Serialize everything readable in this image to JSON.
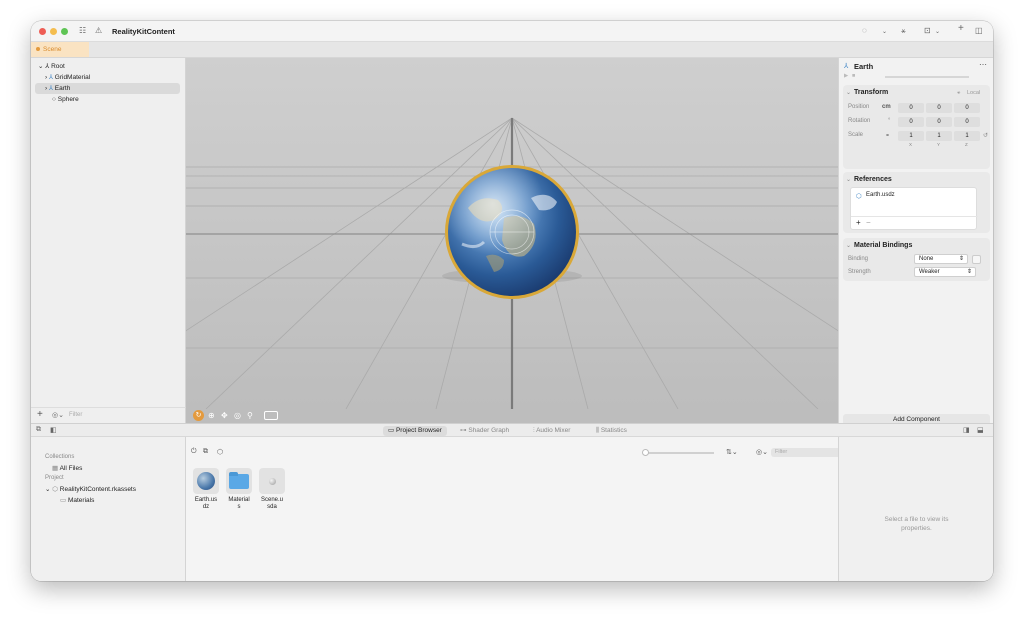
{
  "app": {
    "title": "RealityKitContent"
  },
  "tabs": {
    "scene": "Scene"
  },
  "hierarchy": {
    "root": "Root",
    "items": [
      "GridMaterial",
      "Earth",
      "Sphere"
    ],
    "filter_placeholder": "Filter"
  },
  "inspector": {
    "entity_name": "Earth",
    "transform": {
      "title": "Transform",
      "space": "Local",
      "position_label": "Position",
      "position_unit": "cm",
      "rotation_label": "Rotation",
      "rotation_unit": "°",
      "scale_label": "Scale",
      "position": [
        "0",
        "0",
        "0"
      ],
      "rotation": [
        "0",
        "0",
        "0"
      ],
      "scale": [
        "1",
        "1",
        "1"
      ],
      "axes": [
        "X",
        "Y",
        "Z"
      ]
    },
    "references": {
      "title": "References",
      "items": [
        "Earth.usdz"
      ],
      "add": "+",
      "remove": "−"
    },
    "material_bindings": {
      "title": "Material Bindings",
      "binding_label": "Binding",
      "binding_value": "None",
      "strength_label": "Strength",
      "strength_value": "Weaker"
    },
    "add_component": "Add Component"
  },
  "bottom_tabs": [
    "Project Browser",
    "Shader Graph",
    "Audio Mixer",
    "Statistics"
  ],
  "collections": {
    "section_collections": "Collections",
    "all_files": "All Files",
    "section_project": "Project",
    "project_name": "RealityKitContent.rkassets",
    "materials": "Materials"
  },
  "browser": {
    "filter_placeholder": "Filter",
    "files": [
      {
        "name": "Earth.us\ndz",
        "type": "usdz"
      },
      {
        "name": "Material\ns",
        "type": "folder"
      },
      {
        "name": "Scene.u\nsda",
        "type": "usda"
      }
    ]
  },
  "properties": {
    "empty_text": "Select a file to view its properties."
  },
  "colors": {
    "accent": "#e49a3d",
    "folder": "#5aa8e6",
    "traffic_red": "#ee5d55",
    "traffic_yellow": "#f4bd4f",
    "traffic_green": "#5ec454"
  }
}
